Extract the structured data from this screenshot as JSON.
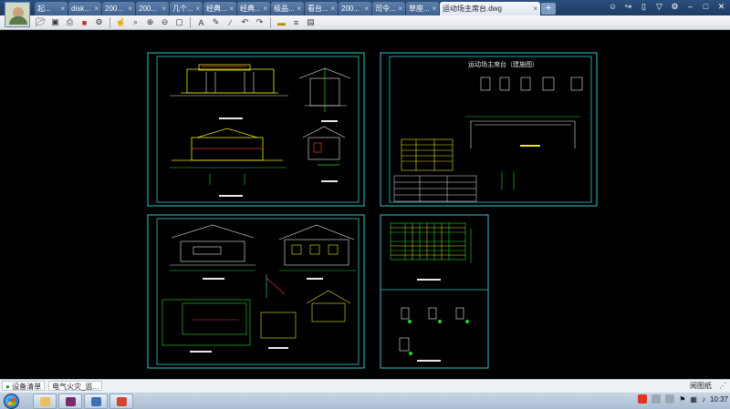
{
  "tabs": [
    {
      "label": "起..."
    },
    {
      "label": "disk..."
    },
    {
      "label": "200..."
    },
    {
      "label": "200..."
    },
    {
      "label": "几个..."
    },
    {
      "label": "经典..."
    },
    {
      "label": "经典..."
    },
    {
      "label": "极品..."
    },
    {
      "label": "看台..."
    },
    {
      "label": "200..."
    },
    {
      "label": "司令..."
    },
    {
      "label": "草座..."
    }
  ],
  "active_tab": {
    "label": "运动场主席台.dwg"
  },
  "new_tab_label": "+",
  "sheets": {
    "top_right_title": "运动场主席台（建施图）"
  },
  "statusbar": {
    "left_items": [
      "设备清单",
      "电气火灾_监..."
    ],
    "right_text": "阅图纸"
  },
  "taskbar": {
    "clock": "10:37"
  },
  "colors": {
    "frame": "#2fc7c7",
    "line_green": "#27d427",
    "line_yellow": "#e6e619",
    "line_cyan": "#36d9e0",
    "line_white": "#e8e8e8",
    "line_red": "#e03a3a",
    "line_magenta": "#d24bd2"
  }
}
